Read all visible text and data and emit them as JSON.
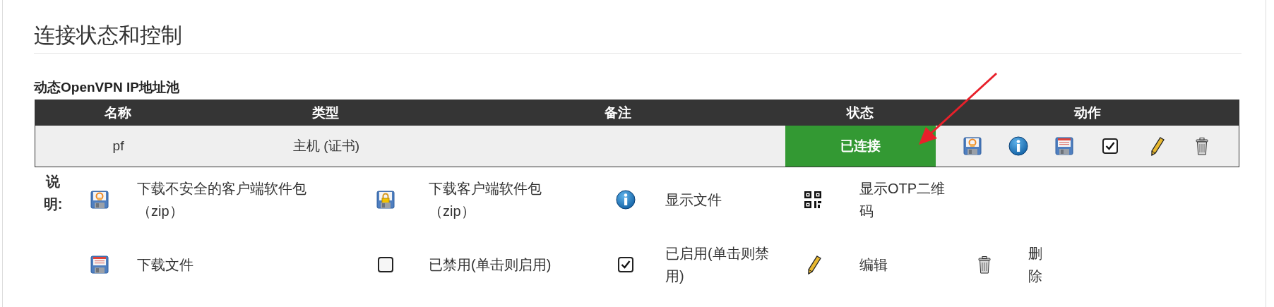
{
  "page_title": "连接状态和控制",
  "section_title": "动态OpenVPN IP地址池",
  "table": {
    "columns": [
      "名称",
      "类型",
      "备注",
      "状态",
      "动作"
    ],
    "rows": [
      {
        "name": "pf",
        "type": "主机 (证书)",
        "status": "已连接",
        "connected": true,
        "actions": [
          {
            "kind": "insecure-package"
          },
          {
            "kind": "info"
          },
          {
            "kind": "file"
          },
          {
            "kind": "enabled"
          },
          {
            "kind": "edit"
          },
          {
            "kind": "delete"
          }
        ]
      }
    ]
  },
  "legend": {
    "label": "说明:",
    "rows": [
      [
        {
          "kind": "insecure-package",
          "text": "下载不安全的客户端软件包（zip）"
        },
        {
          "kind": "package",
          "text": "下载客户端软件包（zip）"
        },
        {
          "kind": "info",
          "text": "显示文件"
        },
        {
          "kind": "qr",
          "text": "显示OTP二维码"
        }
      ],
      [
        {
          "kind": "file",
          "text": "下载文件"
        },
        {
          "kind": "disabled",
          "text": "已禁用(单击则启用)"
        },
        {
          "kind": "enabled",
          "text": "已启用(单击则禁用)"
        },
        {
          "kind": "edit",
          "text": "编辑"
        },
        {
          "kind": "delete",
          "text": "删除"
        }
      ]
    ]
  }
}
